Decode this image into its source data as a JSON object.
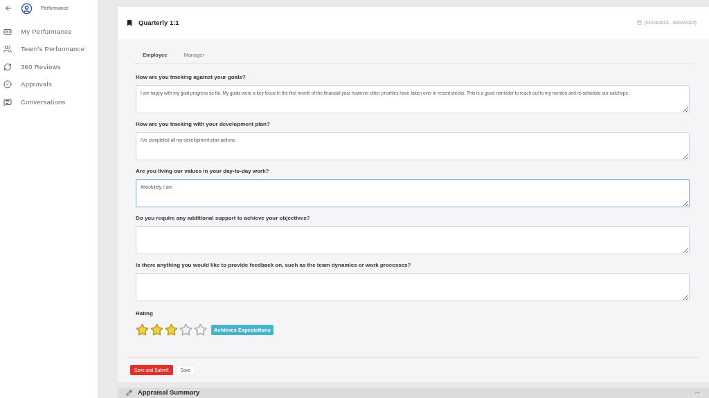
{
  "sidebar": {
    "title": "Performance",
    "items": [
      {
        "label": "My Performance"
      },
      {
        "label": "Team's Performance"
      },
      {
        "label": "360 Reviews"
      },
      {
        "label": "Approvals"
      },
      {
        "label": "Conversations"
      }
    ]
  },
  "card": {
    "title": "Quarterly 1:1",
    "date_range": "(01/04/2023 - 30/04/2023)",
    "tabs": [
      {
        "label": "Employee",
        "selected": true
      },
      {
        "label": "Manager",
        "selected": false
      }
    ],
    "questions": [
      {
        "label": "How are you tracking against your goals?",
        "value": "I am happy with my goal progress so far. My goals were a key focus in the first month of the financial year however other priorities have taken over in recent weeks. This is a good reminder to reach out to my mentee and re-schedule our catchups.",
        "focused": false
      },
      {
        "label": "How are you tracking with your development plan?",
        "value": "I've completed all my development plan actions.",
        "focused": false
      },
      {
        "label": "Are you living our values in your day-to-day work?",
        "value": "Absolutely. I am",
        "focused": true
      },
      {
        "label": "Do you require any additional support to achieve your objectives?",
        "focused": false
      },
      {
        "label": "Is there anything you would like to provide feedback on, such as the team dynamics or work processes?",
        "focused": false
      }
    ],
    "rating": {
      "label": "Rating",
      "stars": 3,
      "badge": "Achieves Expectations"
    },
    "buttons": [
      {
        "label": "Save and Submit",
        "kind": "primary"
      },
      {
        "label": "Save",
        "kind": "secondary"
      }
    ]
  },
  "next_section": {
    "title": "Appraisal Summary"
  }
}
